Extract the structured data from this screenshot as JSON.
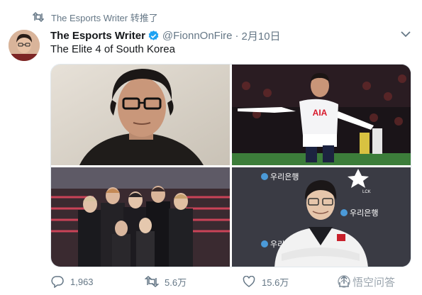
{
  "retweet_context": {
    "text": "The Esports Writer 转推了",
    "icon": "retweet-icon"
  },
  "author": {
    "name": "The Esports Writer",
    "verified": true,
    "handle": "@FionnOnFire",
    "separator": "·",
    "date": "2月10日"
  },
  "tweet": {
    "text": "The Elite 4 of South Korea"
  },
  "media": {
    "photos": [
      {
        "subject": "man-with-glasses-portrait"
      },
      {
        "subject": "football-player-celebrating",
        "jersey_text": "AIA"
      },
      {
        "subject": "music-group-posing"
      },
      {
        "subject": "esports-player-arms-crossed",
        "sponsor_text": "우리은행",
        "badge_text": "LCK"
      }
    ]
  },
  "actions": {
    "reply_count": "1,963",
    "retweet_count": "5.6万",
    "like_count": "15.6万"
  },
  "watermark": {
    "text": "悟空问答"
  },
  "colors": {
    "verified": "#1da1f2",
    "secondary_text": "#657786",
    "primary_text": "#14171a"
  }
}
